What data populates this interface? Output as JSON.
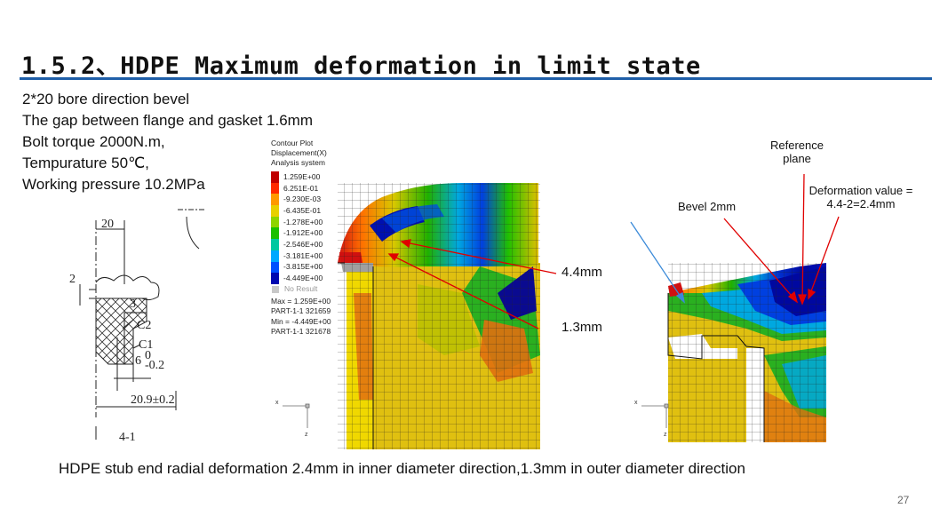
{
  "title": "1.5.2、HDPE Maximum deformation in limit state",
  "params": [
    "2*20 bore direction bevel",
    "The gap between flange and gasket 1.6mm",
    "Bolt torque 2000N.m,",
    "Tempurature 50℃,",
    "Working pressure 10.2MPa"
  ],
  "drawing": {
    "dim_width": "20",
    "dim_gap": "2",
    "label_chamfer": "3",
    "label_c2": "C2",
    "label_c1": "C1",
    "dim_depth": "6",
    "dim_depth_tol_upper": "0",
    "dim_depth_tol_lower": "-0.2",
    "dim_total": "20.9±0.2",
    "fig_ref": "4-1"
  },
  "legend": {
    "header": [
      "Contour Plot",
      "Displacement(X)",
      "Analysis system"
    ],
    "entries": [
      {
        "value": "1.259E+00",
        "color": "#c00000"
      },
      {
        "value": "6.251E-01",
        "color": "#ff2a00"
      },
      {
        "value": "-9.230E-03",
        "color": "#ff9900"
      },
      {
        "value": "-6.435E-01",
        "color": "#e8d000"
      },
      {
        "value": "-1.278E+00",
        "color": "#8ed400"
      },
      {
        "value": "-1.912E+00",
        "color": "#19c000"
      },
      {
        "value": "-2.546E+00",
        "color": "#00c8a0"
      },
      {
        "value": "-3.181E+00",
        "color": "#00a8ff"
      },
      {
        "value": "-3.815E+00",
        "color": "#0050ff"
      },
      {
        "value": "-4.449E+00",
        "color": "#0008b0"
      }
    ],
    "no_result": "No Result",
    "footer": [
      "Max = 1.259E+00",
      "PART-1-1 321659",
      "Min = -4.449E+00",
      "PART-1-1 321678"
    ]
  },
  "annotations": {
    "inner_deformation": "4.4mm",
    "outer_deformation": "1.3mm",
    "reference_plane_line1": "Reference",
    "reference_plane_line2": "plane",
    "bevel": "Bevel 2mm",
    "deformation_value_line1": "Deformation value =",
    "deformation_value_line2": "4.4-2=2.4mm"
  },
  "axes": {
    "x": "x",
    "z": "z"
  },
  "caption": "HDPE stub end radial deformation 2.4mm in inner diameter direction,1.3mm in outer diameter direction",
  "page_number": "27",
  "colors": {
    "title_rule": "#1f5fa8",
    "arrow": "#e00000",
    "bevel_arrow": "#3a8ad8"
  }
}
